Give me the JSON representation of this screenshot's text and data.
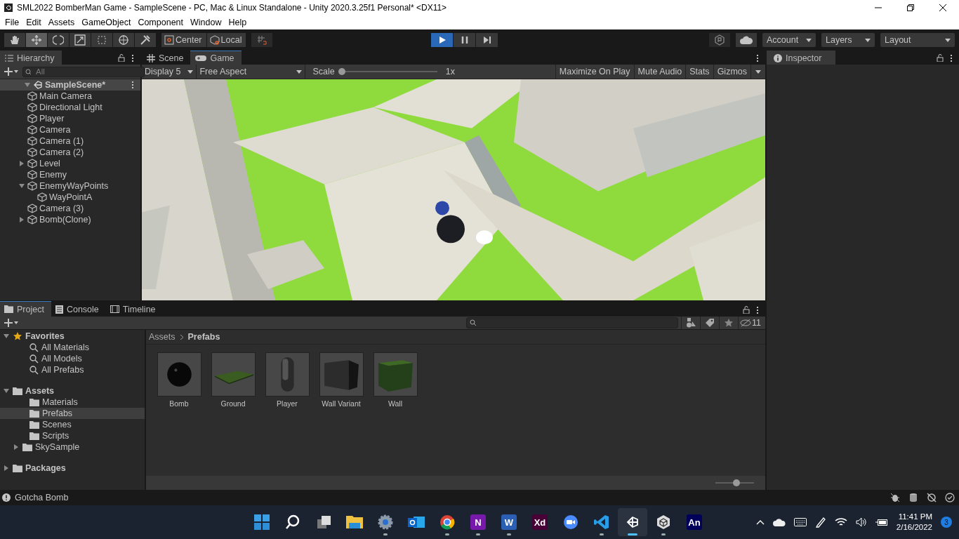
{
  "window": {
    "title": "SML2022 BomberMan Game - SampleScene - PC, Mac & Linux Standalone - Unity 2020.3.25f1 Personal* <DX11>"
  },
  "menu": [
    "File",
    "Edit",
    "Assets",
    "GameObject",
    "Component",
    "Window",
    "Help"
  ],
  "tools": [
    {
      "kind": "hand",
      "selected": false
    },
    {
      "kind": "move",
      "selected": true
    },
    {
      "kind": "rotate",
      "selected": false
    },
    {
      "kind": "scale",
      "selected": false
    },
    {
      "kind": "rect",
      "selected": false
    },
    {
      "kind": "transform",
      "selected": false
    },
    {
      "kind": "custom",
      "selected": false
    }
  ],
  "pivot_buttons": [
    "Center",
    "Local"
  ],
  "play_controls": [
    {
      "kind": "play",
      "on": true
    },
    {
      "kind": "pause",
      "on": false
    },
    {
      "kind": "step",
      "on": false
    }
  ],
  "top_dropdowns": [
    "Account",
    "Layers",
    "Layout"
  ],
  "hierarchy": {
    "tab": "Hierarchy",
    "search_placeholder": "All",
    "tree": [
      {
        "label": "SampleScene*",
        "kind": "scene",
        "expanded": true,
        "children": [
          {
            "label": "Main Camera"
          },
          {
            "label": "Directional Light"
          },
          {
            "label": "Player"
          },
          {
            "label": "Camera"
          },
          {
            "label": "Camera (1)"
          },
          {
            "label": "Camera (2)"
          },
          {
            "label": "Level",
            "expanded": false
          },
          {
            "label": "Enemy"
          },
          {
            "label": "EnemyWayPoints",
            "expanded": true,
            "children": [
              {
                "label": "WayPointA"
              }
            ]
          },
          {
            "label": "Camera (3)"
          },
          {
            "label": "Bomb(Clone)",
            "expanded": false
          }
        ]
      }
    ]
  },
  "view_tabs": [
    {
      "label": "Scene",
      "kind": "scene",
      "selected": false
    },
    {
      "label": "Game",
      "kind": "game",
      "selected": true
    }
  ],
  "game_toolbar": {
    "display": "Display 5",
    "aspect": "Free Aspect",
    "scale_label": "Scale",
    "scale": {
      "level": 0
    },
    "scale_reading": "1x",
    "toggles": [
      {
        "label": "Maximize On Play",
        "on": false
      },
      {
        "label": "Mute Audio",
        "on": false
      },
      {
        "label": "Stats",
        "on": false
      },
      {
        "label": "Gizmos",
        "on": false
      }
    ]
  },
  "inspector": {
    "tab": "Inspector"
  },
  "project_tabs": [
    {
      "label": "Project",
      "kind": "folder",
      "selected": true
    },
    {
      "label": "Console",
      "kind": "console",
      "selected": false
    },
    {
      "label": "Timeline",
      "kind": "film",
      "selected": false
    }
  ],
  "project_tree": [
    {
      "label": "Favorites",
      "kind": "favorites",
      "expanded": true,
      "children": [
        {
          "label": "All Materials",
          "kind": "search"
        },
        {
          "label": "All Models",
          "kind": "search"
        },
        {
          "label": "All Prefabs",
          "kind": "search"
        }
      ]
    },
    {
      "label": "Assets",
      "kind": "folder",
      "expanded": true,
      "children": [
        {
          "label": "Materials",
          "kind": "folder",
          "selected": false
        },
        {
          "label": "Prefabs",
          "kind": "folder",
          "selected": true
        },
        {
          "label": "Scenes",
          "kind": "folder",
          "selected": false
        },
        {
          "label": "Scripts",
          "kind": "folder",
          "selected": false
        },
        {
          "label": "SkySample",
          "kind": "folder",
          "expanded": false,
          "selected": false
        }
      ]
    },
    {
      "label": "Packages",
      "kind": "folder",
      "expanded": false
    }
  ],
  "breadcrumb": [
    "Assets",
    "Prefabs"
  ],
  "hidden_count": "11",
  "assets": [
    {
      "label": "Bomb",
      "kind": "sphere"
    },
    {
      "label": "Ground",
      "kind": "plane"
    },
    {
      "label": "Player",
      "kind": "capsule"
    },
    {
      "label": "Wall Variant",
      "kind": "dark-cube"
    },
    {
      "label": "Wall",
      "kind": "green-cube"
    }
  ],
  "thumb_size": {
    "level": 0.55
  },
  "status_bar": {
    "message": "Gotcha Bomb"
  },
  "taskbar": {
    "apps": [
      {
        "kind": "start",
        "running": false,
        "selected": false
      },
      {
        "kind": "search",
        "running": false,
        "selected": false
      },
      {
        "kind": "task-view",
        "running": false,
        "selected": false
      },
      {
        "kind": "folder",
        "running": false,
        "selected": false
      },
      {
        "kind": "gear",
        "running": true,
        "selected": false
      },
      {
        "kind": "mail",
        "running": false,
        "selected": false
      },
      {
        "kind": "browser",
        "running": true,
        "selected": false
      },
      {
        "kind": "letter",
        "glyph": "N",
        "color": "#7719aa",
        "running": true,
        "selected": false
      },
      {
        "kind": "letter",
        "glyph": "W",
        "color": "#2b5fb4",
        "running": true,
        "selected": false
      },
      {
        "kind": "letter",
        "glyph": "Xd",
        "color": "#470137",
        "running": false,
        "selected": false
      },
      {
        "kind": "camera",
        "running": false,
        "selected": false
      },
      {
        "kind": "code",
        "running": true,
        "selected": false
      },
      {
        "kind": "cube-dark",
        "running": true,
        "selected": true
      },
      {
        "kind": "cube-light",
        "running": true,
        "selected": false
      },
      {
        "kind": "letter",
        "glyph": "An",
        "color": "#00005b",
        "running": false,
        "selected": false
      }
    ],
    "time": "11:41 PM",
    "date": "2/16/2022",
    "notifications": "3"
  }
}
